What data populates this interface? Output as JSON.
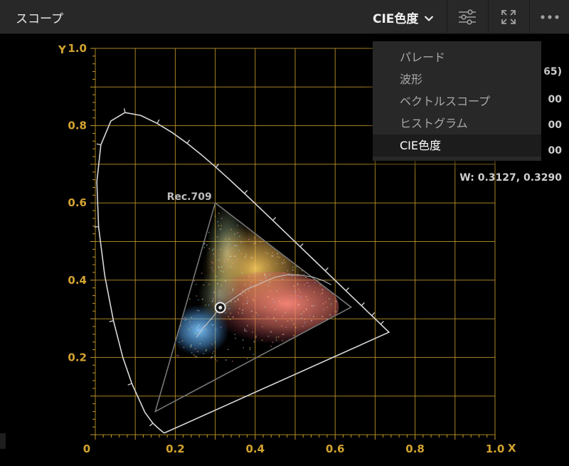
{
  "header": {
    "title": "スコープ",
    "mode": "CIE色度"
  },
  "dropdown": {
    "items": [
      {
        "label": "パレード",
        "selected": false
      },
      {
        "label": "波形",
        "selected": false
      },
      {
        "label": "ベクトルスコープ",
        "selected": false
      },
      {
        "label": "ヒストグラム",
        "selected": false
      },
      {
        "label": "CIE色度",
        "selected": true
      }
    ]
  },
  "info": {
    "line1_fragment": "65)",
    "line2_fragment": "00",
    "line3_fragment": "00",
    "line4_fragment": "00",
    "white_point": "W: 0.3127, 0.3290"
  },
  "icons": {
    "settings": "sliders-icon",
    "expand": "expand-icon",
    "more": "more-icon",
    "chevron": "chevron-down-icon"
  },
  "colors": {
    "grid": "#c49a2c",
    "axis_label": "#d4a430",
    "locus": "#d8d8d8",
    "gamut": "#777777"
  },
  "chart_data": {
    "type": "scatter",
    "x_axis_label": "X",
    "y_axis_label": "Y",
    "x_ticks": [
      "0",
      "0.2",
      "0.4",
      "0.6",
      "0.8",
      "1.0"
    ],
    "y_ticks": [
      "0.2",
      "0.4",
      "0.6",
      "0.8",
      "1.0"
    ],
    "xlim": [
      0,
      1
    ],
    "ylim": [
      0,
      1
    ],
    "gamut_label": "Rec.709",
    "gamut": [
      [
        0.64,
        0.33
      ],
      [
        0.3,
        0.6
      ],
      [
        0.15,
        0.06
      ]
    ],
    "white_point": [
      0.3127,
      0.329
    ],
    "spectral_locus": [
      [
        0.1741,
        0.005
      ],
      [
        0.1738,
        0.0049
      ],
      [
        0.1733,
        0.0048
      ],
      [
        0.1726,
        0.0048
      ],
      [
        0.1714,
        0.0051
      ],
      [
        0.1689,
        0.0069
      ],
      [
        0.1644,
        0.0109
      ],
      [
        0.1566,
        0.0177
      ],
      [
        0.144,
        0.0297
      ],
      [
        0.1241,
        0.0578
      ],
      [
        0.0913,
        0.1327
      ],
      [
        0.0687,
        0.2007
      ],
      [
        0.0454,
        0.295
      ],
      [
        0.0235,
        0.4127
      ],
      [
        0.0082,
        0.5384
      ],
      [
        0.0039,
        0.6548
      ],
      [
        0.0139,
        0.7502
      ],
      [
        0.0389,
        0.812
      ],
      [
        0.0743,
        0.8338
      ],
      [
        0.1142,
        0.8262
      ],
      [
        0.1547,
        0.8059
      ],
      [
        0.1929,
        0.7816
      ],
      [
        0.2296,
        0.7543
      ],
      [
        0.2658,
        0.7243
      ],
      [
        0.3016,
        0.6923
      ],
      [
        0.3373,
        0.6589
      ],
      [
        0.3731,
        0.6245
      ],
      [
        0.4087,
        0.5896
      ],
      [
        0.4441,
        0.5547
      ],
      [
        0.4788,
        0.5202
      ],
      [
        0.5125,
        0.4866
      ],
      [
        0.5448,
        0.4544
      ],
      [
        0.5752,
        0.4242
      ],
      [
        0.6029,
        0.3965
      ],
      [
        0.627,
        0.3725
      ],
      [
        0.6482,
        0.3514
      ],
      [
        0.6658,
        0.334
      ],
      [
        0.6801,
        0.3197
      ],
      [
        0.6915,
        0.3083
      ],
      [
        0.7006,
        0.2993
      ],
      [
        0.714,
        0.2859
      ],
      [
        0.7219,
        0.278
      ],
      [
        0.7347,
        0.2653
      ]
    ],
    "planckian_locus": [
      [
        0.253,
        0.252
      ],
      [
        0.27,
        0.276
      ],
      [
        0.29,
        0.3
      ],
      [
        0.3127,
        0.329
      ],
      [
        0.345,
        0.352
      ],
      [
        0.38,
        0.377
      ],
      [
        0.414,
        0.392
      ],
      [
        0.45,
        0.408
      ],
      [
        0.48,
        0.414
      ],
      [
        0.515,
        0.413
      ],
      [
        0.545,
        0.408
      ],
      [
        0.57,
        0.399
      ],
      [
        0.59,
        0.388
      ]
    ]
  }
}
